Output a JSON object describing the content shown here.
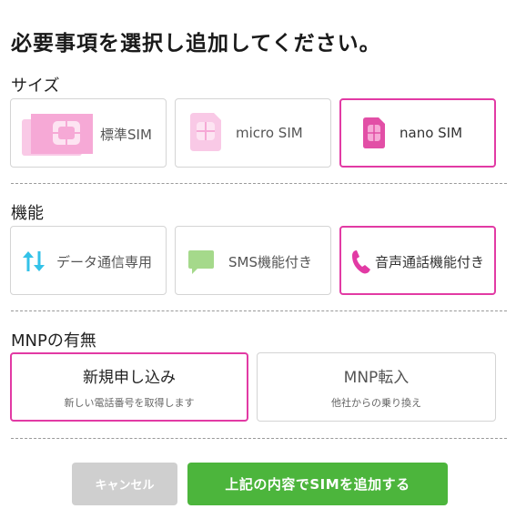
{
  "title": "必要事項を選択し追加してください。",
  "size": {
    "label": "サイズ",
    "options": [
      {
        "label": "標準SIM",
        "icon": "standard-sim-icon",
        "selected": false
      },
      {
        "label": "micro SIM",
        "icon": "micro-sim-icon",
        "selected": false
      },
      {
        "label": "nano SIM",
        "icon": "nano-sim-icon",
        "selected": true
      }
    ]
  },
  "function": {
    "label": "機能",
    "options": [
      {
        "label": "データ通信専用",
        "icon": "data-transfer-arrows-icon",
        "selected": false
      },
      {
        "label": "SMS機能付き",
        "icon": "sms-bubble-icon",
        "selected": false
      },
      {
        "label": "音声通話機能付き",
        "icon": "phone-icon",
        "selected": true
      }
    ]
  },
  "mnp": {
    "label": "MNPの有無",
    "options": [
      {
        "main": "新規申し込み",
        "sub": "新しい電話番号を取得します",
        "selected": true
      },
      {
        "main": "MNP転入",
        "sub": "他社からの乗り換え",
        "selected": false
      }
    ]
  },
  "buttons": {
    "cancel": "キャンセル",
    "add": "上記の内容でSIMを追加する"
  },
  "colors": {
    "selected_border": "#e23aa4",
    "sim_pink": "#f6a9d6",
    "sim_pink_dark": "#e24fa6",
    "arrow_cyan": "#33c2e8",
    "sms_green": "#a5d98b",
    "phone_pink": "#e23aa4",
    "cancel_gray": "#cfcfcf",
    "add_green": "#4cb53c"
  }
}
